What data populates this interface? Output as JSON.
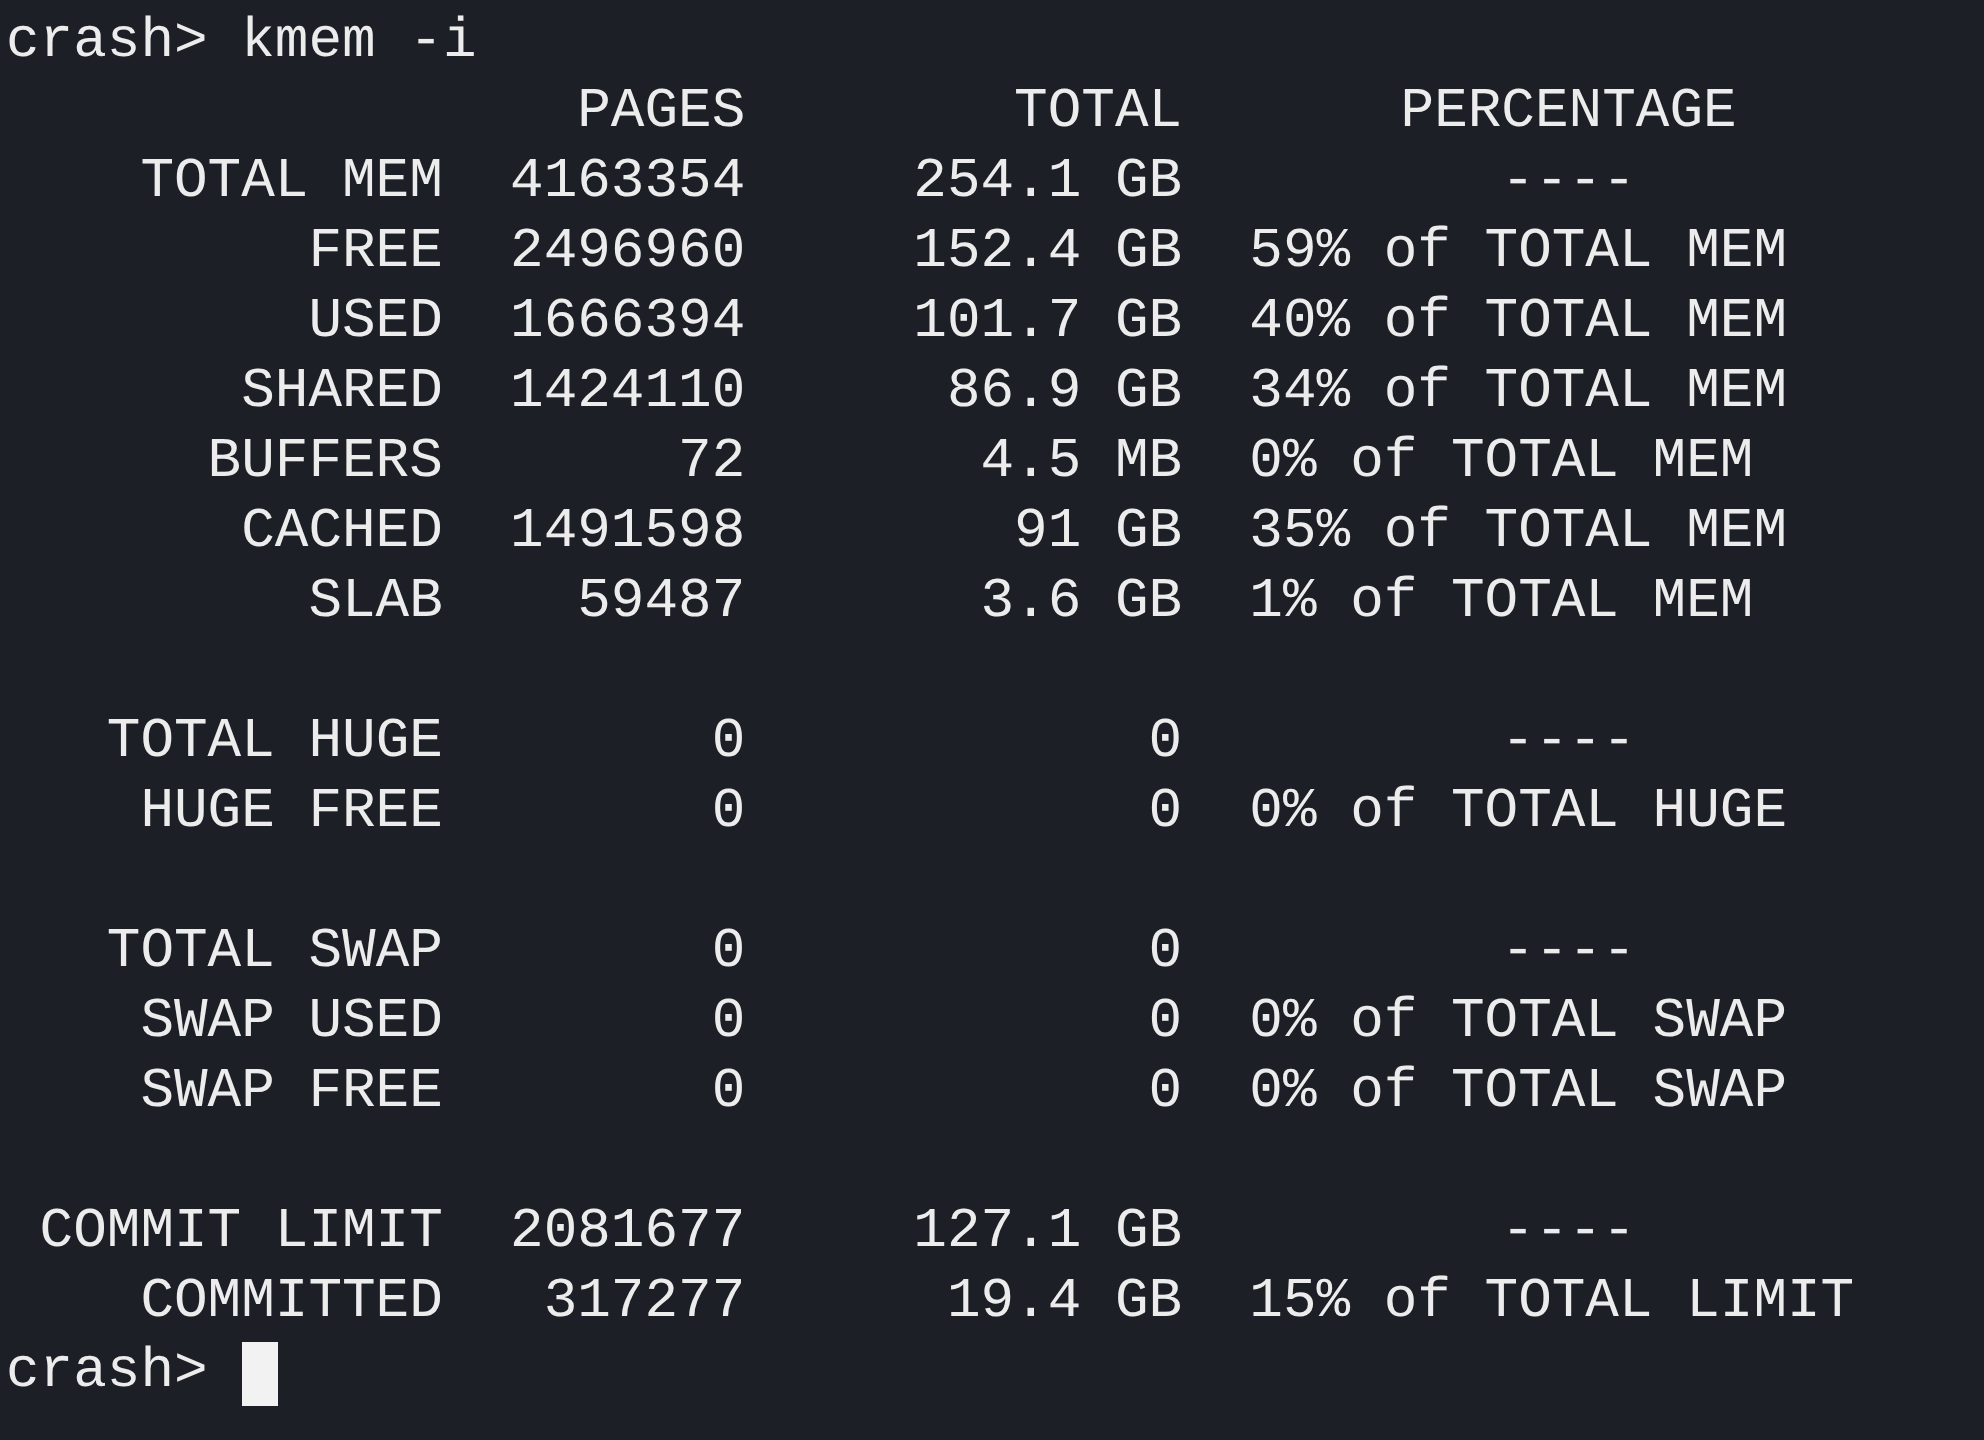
{
  "command": {
    "prompt": "crash>",
    "text": "kmem -i"
  },
  "columns": [
    "PAGES",
    "TOTAL",
    "PERCENTAGE"
  ],
  "groups": [
    {
      "rows": [
        {
          "label": "TOTAL MEM",
          "pages": "4163354",
          "total": "254.1 GB",
          "percentage": "----",
          "kind": "dash"
        },
        {
          "label": "FREE",
          "pages": "2496960",
          "total": "152.4 GB",
          "percentage": "59% of TOTAL MEM",
          "kind": "percent"
        },
        {
          "label": "USED",
          "pages": "1666394",
          "total": "101.7 GB",
          "percentage": "40% of TOTAL MEM",
          "kind": "percent"
        },
        {
          "label": "SHARED",
          "pages": "1424110",
          "total": "86.9 GB",
          "percentage": "34% of TOTAL MEM",
          "kind": "percent"
        },
        {
          "label": "BUFFERS",
          "pages": "72",
          "total": "4.5 MB",
          "percentage": "0% of TOTAL MEM",
          "kind": "percent"
        },
        {
          "label": "CACHED",
          "pages": "1491598",
          "total": "91 GB",
          "percentage": "35% of TOTAL MEM",
          "kind": "percent"
        },
        {
          "label": "SLAB",
          "pages": "59487",
          "total": "3.6 GB",
          "percentage": "1% of TOTAL MEM",
          "kind": "percent"
        }
      ]
    },
    {
      "rows": [
        {
          "label": "TOTAL HUGE",
          "pages": "0",
          "total": "0",
          "percentage": "----",
          "kind": "dash"
        },
        {
          "label": "HUGE FREE",
          "pages": "0",
          "total": "0",
          "percentage": "0% of TOTAL HUGE",
          "kind": "percent"
        }
      ]
    },
    {
      "rows": [
        {
          "label": "TOTAL SWAP",
          "pages": "0",
          "total": "0",
          "percentage": "----",
          "kind": "dash"
        },
        {
          "label": "SWAP USED",
          "pages": "0",
          "total": "0",
          "percentage": "0% of TOTAL SWAP",
          "kind": "percent"
        },
        {
          "label": "SWAP FREE",
          "pages": "0",
          "total": "0",
          "percentage": "0% of TOTAL SWAP",
          "kind": "percent"
        }
      ]
    },
    {
      "rows": [
        {
          "label": "COMMIT LIMIT",
          "pages": "2081677",
          "total": "127.1 GB",
          "percentage": "----",
          "kind": "dash"
        },
        {
          "label": "COMMITTED",
          "pages": "317277",
          "total": "19.4 GB",
          "percentage": "15% of TOTAL LIMIT",
          "kind": "percent"
        }
      ]
    }
  ],
  "final_prompt": {
    "prompt": "crash>"
  }
}
